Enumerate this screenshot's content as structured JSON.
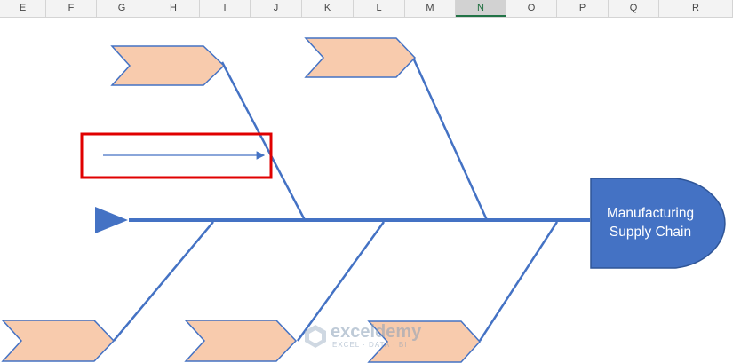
{
  "columns": [
    "E",
    "F",
    "G",
    "H",
    "I",
    "J",
    "K",
    "L",
    "M",
    "N",
    "O",
    "P",
    "Q",
    "R"
  ],
  "selected_column": "N",
  "diagram": {
    "head_label_line1": "Manufacturing",
    "head_label_line2": "Supply Chain",
    "colors": {
      "spine": "#4472c4",
      "bone": "#4472c4",
      "cause_fill": "#f8cbad",
      "cause_stroke": "#4472c4",
      "head_fill": "#4472c4",
      "highlight": "#e00000",
      "arrow_line": "#4472c4"
    }
  },
  "watermark": {
    "name": "exceldemy",
    "tagline": "EXCEL · DATA · BI"
  }
}
